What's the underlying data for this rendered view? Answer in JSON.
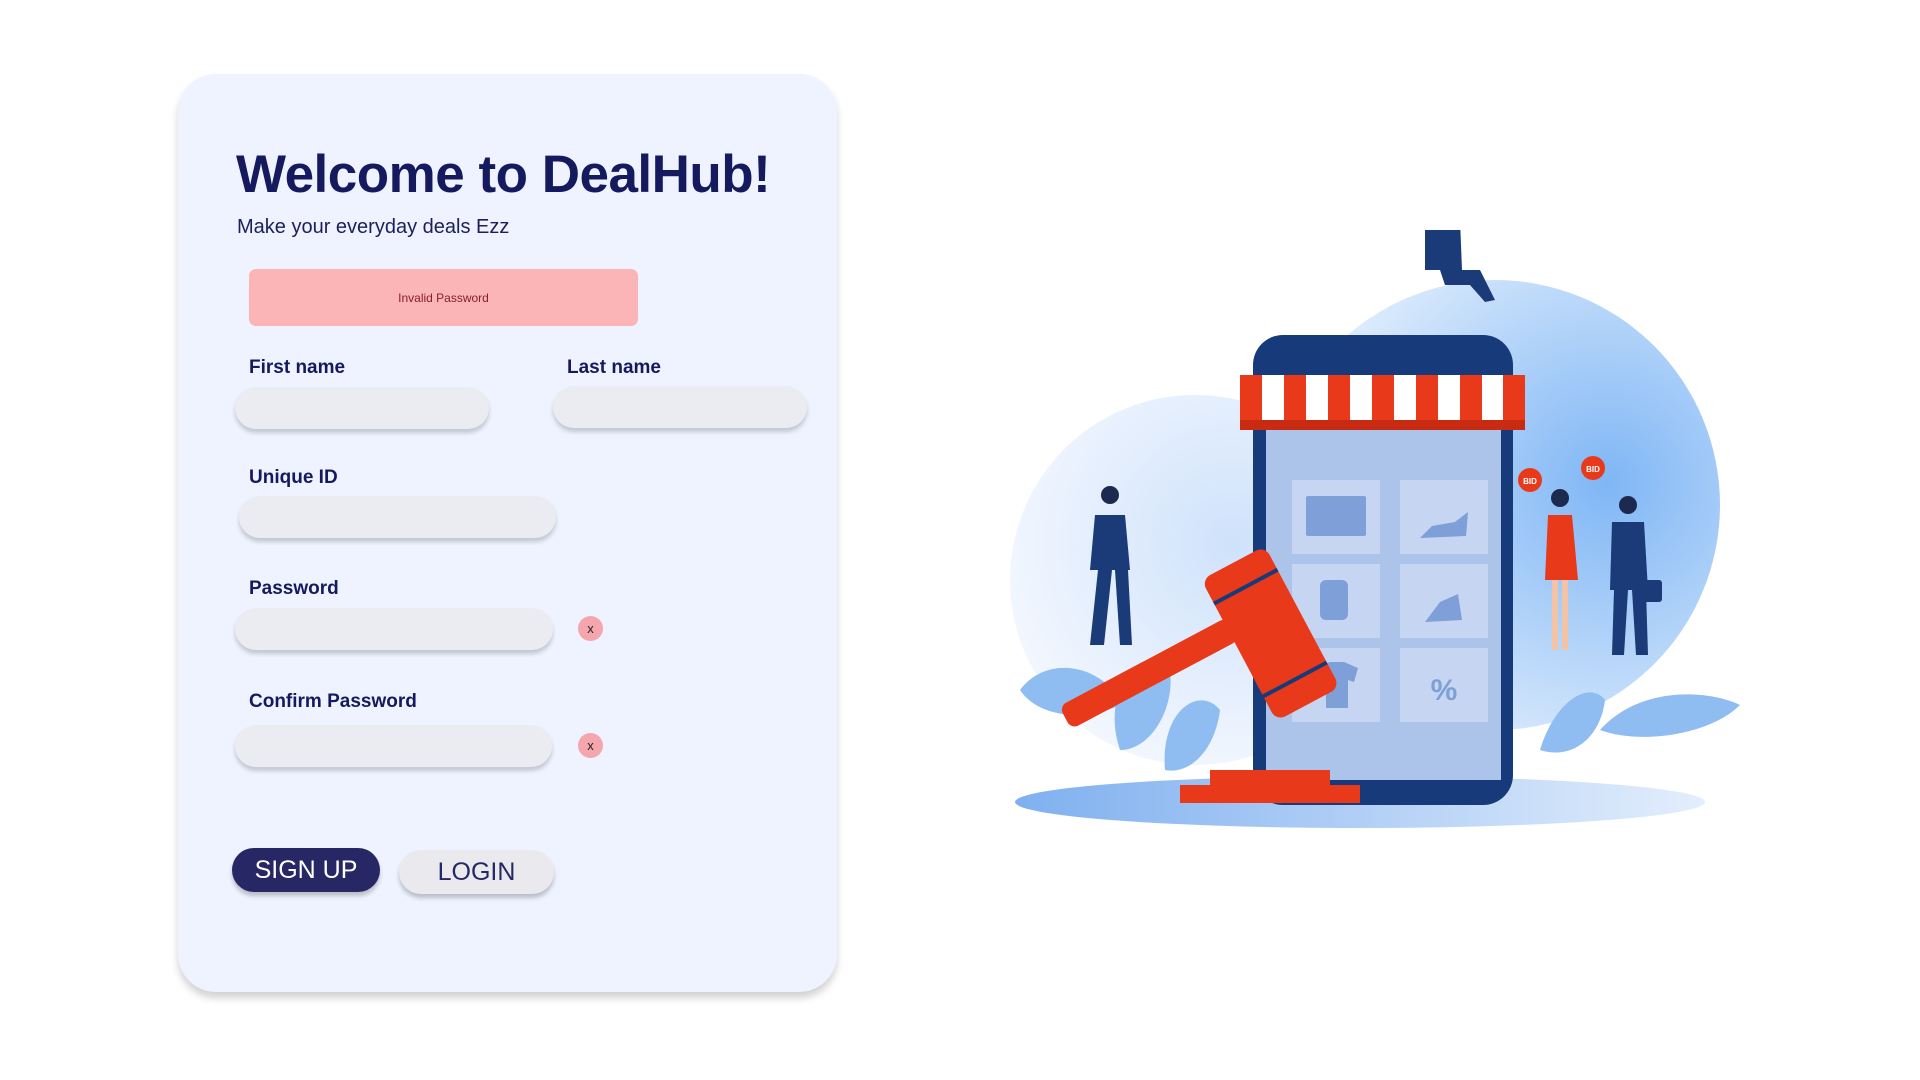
{
  "app": {
    "title": "Welcome to DealHub!",
    "subtitle": "Make your everyday deals Ezz"
  },
  "error": {
    "message": "Invalid Password"
  },
  "form": {
    "first_name": {
      "label": "First name",
      "value": "",
      "placeholder": ""
    },
    "last_name": {
      "label": "Last name",
      "value": "",
      "placeholder": ""
    },
    "unique_id": {
      "label": "Unique ID",
      "value": "",
      "placeholder": ""
    },
    "password": {
      "label": "Password",
      "value": "",
      "placeholder": ""
    },
    "confirm_password": {
      "label": "Confirm Password",
      "value": "",
      "placeholder": ""
    },
    "clear_glyph": "x"
  },
  "actions": {
    "signup_label": "SIGN UP",
    "login_label": "LOGIN"
  },
  "illustration": {
    "bid_tag_text": "BID",
    "icons": [
      "megaphone-icon",
      "gavel-icon",
      "shoe-icon",
      "watch-icon",
      "heel-icon",
      "shirt-icon",
      "percent-icon",
      "briefcase-icon"
    ]
  },
  "colors": {
    "card_bg": "#eef3ff",
    "title": "#15195e",
    "error_bg": "#fbb5b7",
    "primary_button": "#262764",
    "secondary_button": "#eaeaee",
    "awning_red": "#e8391a",
    "phone_navy": "#163a7a"
  }
}
